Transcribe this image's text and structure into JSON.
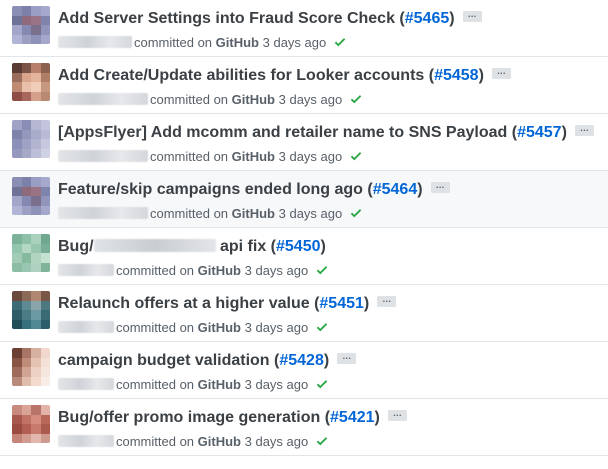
{
  "commits": [
    {
      "title": "Add Server Settings into Fraud Score Check (",
      "pr": "#5465",
      "close": ")",
      "meta_committed": "committed on",
      "meta_platform": "GitHub",
      "meta_time": "3 days ago",
      "ellipsis": "…",
      "status_icon": "check-icon",
      "avatar_colors": [
        "#8a8eb4",
        "#7d80a8",
        "#9b9ec4",
        "#a6a9cc",
        "#6e7297",
        "#8e6a7a",
        "#9a7384",
        "#7f84ac",
        "#a3a6c9",
        "#8589b2",
        "#7b6f8e",
        "#9295bb",
        "#b1b4d4",
        "#9da0c3",
        "#8e91b8",
        "#a5a8ca"
      ]
    },
    {
      "title": "Add Create/Update abilities for Looker accounts (",
      "pr": "#5458",
      "close": ")",
      "meta_committed": "committed on",
      "meta_platform": "GitHub",
      "meta_time": "3 days ago",
      "ellipsis": "…",
      "status_icon": "check-icon",
      "avatar_colors": [
        "#5a3b33",
        "#7a5446",
        "#b8806a",
        "#8c6150",
        "#9a6c5c",
        "#d9a48c",
        "#e3b39c",
        "#b07d66",
        "#c08a72",
        "#e8c0aa",
        "#f0cdb8",
        "#c79880",
        "#8e4e45",
        "#a7675c",
        "#d5a08a",
        "#b88a74"
      ]
    },
    {
      "title": "[AppsFlyer] Add mcomm and retailer name to SNS Payload (",
      "pr": "#5457",
      "close": ")",
      "meta_committed": "committed on",
      "meta_platform": "GitHub",
      "meta_time": "3 days ago",
      "ellipsis": "…",
      "status_icon": "check-icon",
      "avatar_colors": [
        "#a0a3c6",
        "#8a8db5",
        "#b4b6d2",
        "#c3c5dd",
        "#7f82ab",
        "#9598bd",
        "#a9abca",
        "#b9bbd6",
        "#8c8fb7",
        "#9fa2c4",
        "#b2b4d0",
        "#c6c8df",
        "#9699be",
        "#a6a8c8",
        "#bdbfd8",
        "#cfd1e5"
      ]
    },
    {
      "title": "Feature/skip campaigns ended long ago (",
      "pr": "#5464",
      "close": ")",
      "meta_committed": "committed on",
      "meta_platform": "GitHub",
      "meta_time": "3 days ago",
      "ellipsis": "…",
      "status_icon": "check-icon",
      "avatar_colors": [
        "#8a8eb4",
        "#7d80a8",
        "#9b9ec4",
        "#a6a9cc",
        "#6e7297",
        "#8e6a7a",
        "#9a7384",
        "#7f84ac",
        "#a3a6c9",
        "#8589b2",
        "#7b6f8e",
        "#9295bb",
        "#b1b4d4",
        "#9da0c3",
        "#8e91b8",
        "#a5a8ca"
      ]
    },
    {
      "title_a": "Bug/",
      "title_b": " api fix (",
      "pr": "#5450",
      "close": ")",
      "meta_committed": "committed on",
      "meta_platform": "GitHub",
      "meta_time": "3 days ago",
      "status_icon": "check-icon",
      "avatar_colors": [
        "#7bb39a",
        "#8cc0a8",
        "#a9d2bc",
        "#6fa88e",
        "#93c4ad",
        "#b5d8c5",
        "#98c6b0",
        "#7aae96",
        "#a3ccb7",
        "#86ba9f",
        "#b0d4c0",
        "#c4e1d1",
        "#8bbda4",
        "#9ac7b1",
        "#aed2bf",
        "#7fb39a"
      ]
    },
    {
      "title": "Relaunch offers at a higher value (",
      "pr": "#5451",
      "close": ")",
      "meta_committed": "committed on",
      "meta_platform": "GitHub",
      "meta_time": "3 days ago",
      "ellipsis": "…",
      "status_icon": "check-icon",
      "avatar_colors": [
        "#6b4a3e",
        "#8c6a58",
        "#b08872",
        "#7a5646",
        "#3d6b74",
        "#5e8a93",
        "#8aa5a9",
        "#4e7880",
        "#2f5d67",
        "#4b7c86",
        "#6a99a2",
        "#3a6a74",
        "#1f4d58",
        "#35707c",
        "#508893",
        "#2a5d69"
      ]
    },
    {
      "title": "campaign budget validation (",
      "pr": "#5428",
      "close": ")",
      "meta_committed": "committed on",
      "meta_platform": "GitHub",
      "meta_time": "3 days ago",
      "ellipsis": "…",
      "status_icon": "check-icon",
      "avatar_colors": [
        "#6b3f34",
        "#a87565",
        "#d6b0a0",
        "#f0d9cc",
        "#8a5445",
        "#c08c7a",
        "#e5c3b3",
        "#f3e1d7",
        "#9e6a5a",
        "#d2a493",
        "#ecd0c3",
        "#f5e6de",
        "#b88a7a",
        "#e0bcad",
        "#f2dacd",
        "#f8ede7"
      ]
    },
    {
      "title": "Bug/offer promo image generation (",
      "pr": "#5421",
      "close": ")",
      "meta_committed": "committed on",
      "meta_platform": "GitHub",
      "meta_time": "3 days ago",
      "ellipsis": "…",
      "status_icon": "check-icon",
      "avatar_colors": [
        "#c98a7e",
        "#d9a398",
        "#b87468",
        "#e2b4a9",
        "#a8584c",
        "#c27165",
        "#d58d80",
        "#b96759",
        "#9c4b40",
        "#b25e52",
        "#c87a6d",
        "#ad5a4e",
        "#c48477",
        "#d39c90",
        "#e2b7ad",
        "#cf9a8e"
      ]
    }
  ],
  "accent": "#0366d6",
  "check_color": "#28a745"
}
